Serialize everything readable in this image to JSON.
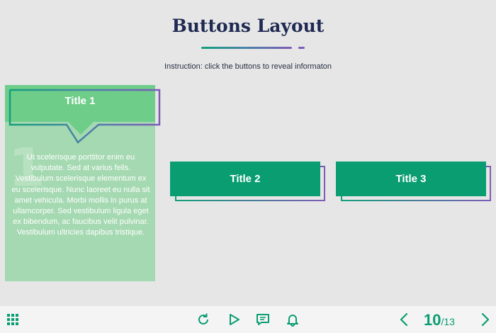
{
  "header": {
    "title": "Buttons Layout",
    "instruction": "Instruction: click the buttons to reveal informaton"
  },
  "cards": [
    {
      "number": "1",
      "title": "Title 1",
      "expanded": true,
      "text": "Ut scelerisque porttitor enim eu vulputate. Sed at varius felis. Vestibulum scelerisque elementum ex eu scelerisque. Nunc laoreet eu nulla sit amet vehicula. Morbi mollis in purus at ullamcorper. Sed vestibulum ligula eget ex bibendum, ac faucibus velit pulvinar. Vestibulum ultricies dapibus tristique."
    },
    {
      "title": "Title 2",
      "expanded": false
    },
    {
      "title": "Title 3",
      "expanded": false
    }
  ],
  "toolbar": {
    "icons": {
      "menu": "grid-icon",
      "replay": "replay-icon",
      "play": "play-icon",
      "notes": "chat-icon",
      "notifications": "bell-icon",
      "prev": "chevron-left-icon",
      "next": "chevron-right-icon"
    },
    "page_current": "10",
    "page_total": "/13"
  },
  "colors": {
    "background": "#e6e6e6",
    "primary_green": "#0a9d72",
    "light_green": "#6fcd8a",
    "card_bg": "#a5d9b1",
    "purple": "#7c5cb8",
    "title_navy": "#1f2a52"
  }
}
